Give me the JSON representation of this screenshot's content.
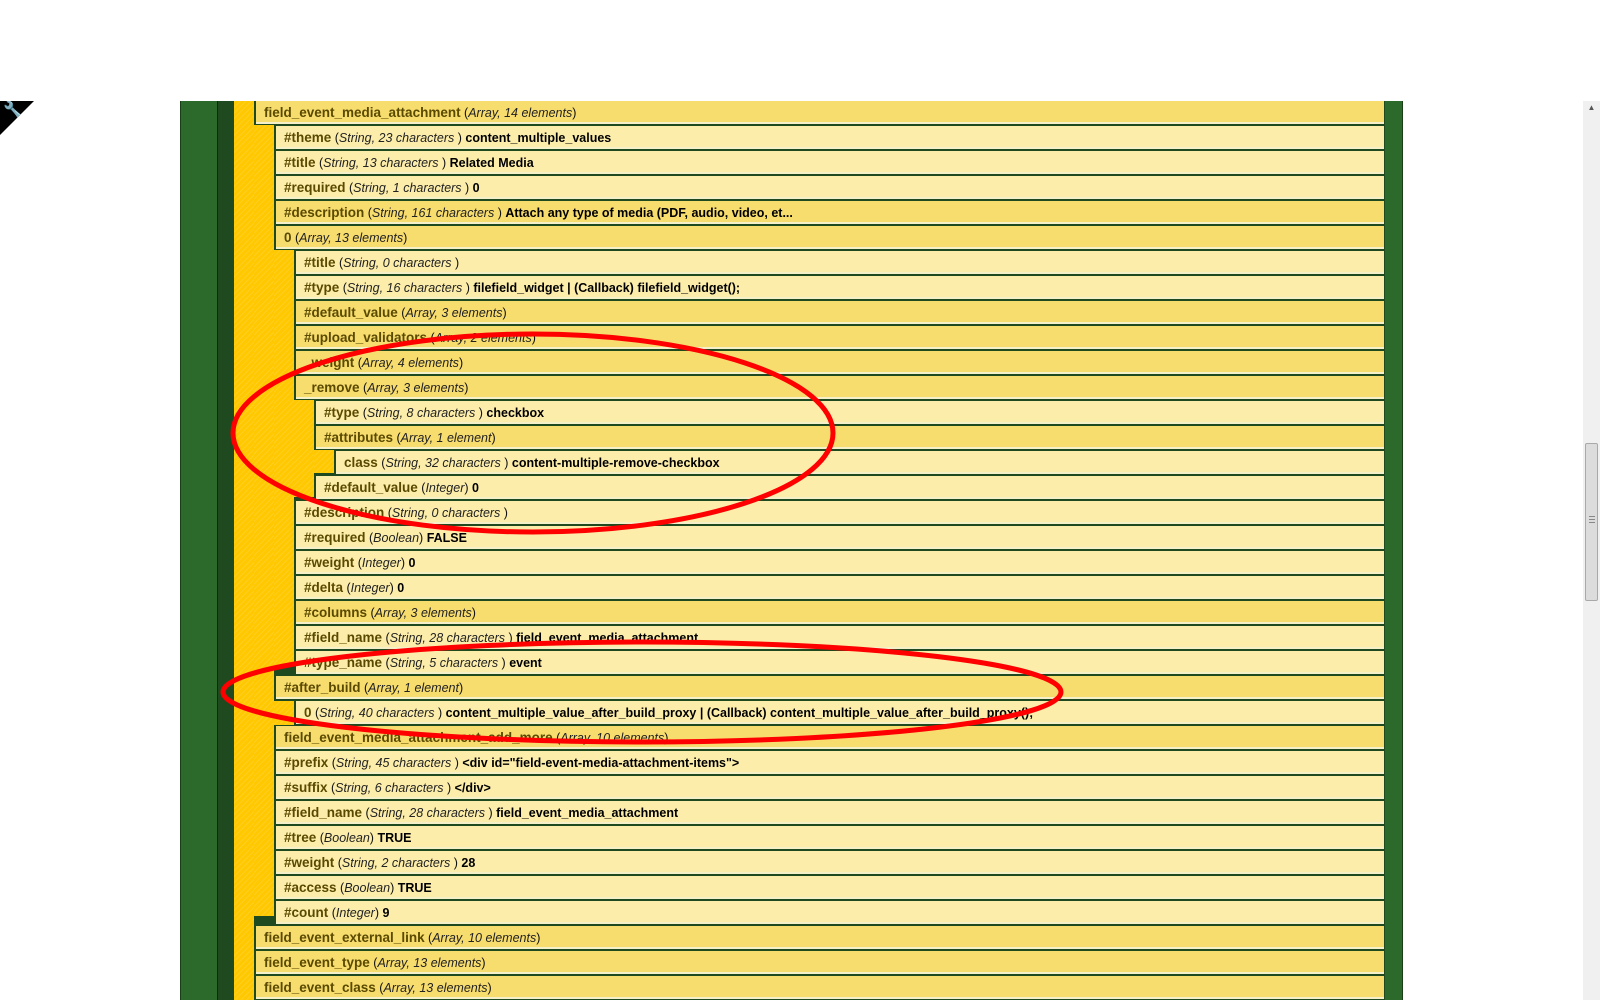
{
  "toolbar": {
    "wrench_icon": "wrench-icon",
    "wrench_glyph": "🔧"
  },
  "rows": {
    "r0": {
      "k": "field_event_media_attachment",
      "t": "Array, 14 elements",
      "v": ""
    },
    "r1": {
      "k": "#theme",
      "t": "String, 23 characters ",
      "v": "content_multiple_values"
    },
    "r2": {
      "k": "#title",
      "t": "String, 13 characters ",
      "v": "Related Media"
    },
    "r3": {
      "k": "#required",
      "t": "String, 1 characters ",
      "v": "0"
    },
    "r4": {
      "k": "#description",
      "t": "String, 161 characters ",
      "v": "Attach any type of media (PDF, audio, video, et..."
    },
    "r5": {
      "k": "0",
      "t": "Array, 13 elements",
      "v": ""
    },
    "r6": {
      "k": "#title",
      "t": "String, 0 characters ",
      "v": ""
    },
    "r7": {
      "k": "#type",
      "t": "String, 16 characters ",
      "v": "filefield_widget | (Callback) filefield_widget();"
    },
    "r8": {
      "k": "#default_value",
      "t": "Array, 3 elements",
      "v": ""
    },
    "r9": {
      "k": "#upload_validators",
      "t": "Array, 2 elements",
      "v": ""
    },
    "r10": {
      "k": "_weight",
      "t": "Array, 4 elements",
      "v": ""
    },
    "r11": {
      "k": "_remove",
      "t": "Array, 3 elements",
      "v": ""
    },
    "r12": {
      "k": "#type",
      "t": "String, 8 characters ",
      "v": "checkbox"
    },
    "r13": {
      "k": "#attributes",
      "t": "Array, 1 element",
      "v": ""
    },
    "r14": {
      "k": "class",
      "t": "String, 32 characters ",
      "v": "content-multiple-remove-checkbox"
    },
    "r15": {
      "k": "#default_value",
      "t": "Integer",
      "v": "0"
    },
    "r16": {
      "k": "#description",
      "t": "String, 0 characters ",
      "v": ""
    },
    "r17": {
      "k": "#required",
      "t": "Boolean",
      "v": "FALSE"
    },
    "r18": {
      "k": "#weight",
      "t": "Integer",
      "v": "0"
    },
    "r19": {
      "k": "#delta",
      "t": "Integer",
      "v": "0"
    },
    "r20": {
      "k": "#columns",
      "t": "Array, 3 elements",
      "v": ""
    },
    "r21": {
      "k": "#field_name",
      "t": "String, 28 characters ",
      "v": "field_event_media_attachment"
    },
    "r22": {
      "k": "#type_name",
      "t": "String, 5 characters ",
      "v": "event"
    },
    "r23": {
      "k": "#after_build",
      "t": "Array, 1 element",
      "v": ""
    },
    "r24": {
      "k": "0",
      "t": "String, 40 characters ",
      "v": "content_multiple_value_after_build_proxy | (Callback) content_multiple_value_after_build_proxy();"
    },
    "r25": {
      "k": "field_event_media_attachment_add_more",
      "t": "Array, 10 elements",
      "v": ""
    },
    "r26": {
      "k": "#prefix",
      "t": "String, 45 characters ",
      "v": "<div id=\"field-event-media-attachment-items\">"
    },
    "r27": {
      "k": "#suffix",
      "t": "String, 6 characters ",
      "v": "</div>"
    },
    "r28": {
      "k": "#field_name",
      "t": "String, 28 characters ",
      "v": "field_event_media_attachment"
    },
    "r29": {
      "k": "#tree",
      "t": "Boolean",
      "v": "TRUE"
    },
    "r30": {
      "k": "#weight",
      "t": "String, 2 characters ",
      "v": "28"
    },
    "r31": {
      "k": "#access",
      "t": "Boolean",
      "v": "TRUE"
    },
    "r32": {
      "k": "#count",
      "t": "Integer",
      "v": "9"
    },
    "r33": {
      "k": "field_event_external_link",
      "t": "Array, 10 elements",
      "v": ""
    },
    "r34": {
      "k": "field_event_type",
      "t": "Array, 13 elements",
      "v": ""
    },
    "r35": {
      "k": "field_event_class",
      "t": "Array, 13 elements",
      "v": ""
    }
  },
  "annotations": {
    "color": "#ff0000"
  }
}
